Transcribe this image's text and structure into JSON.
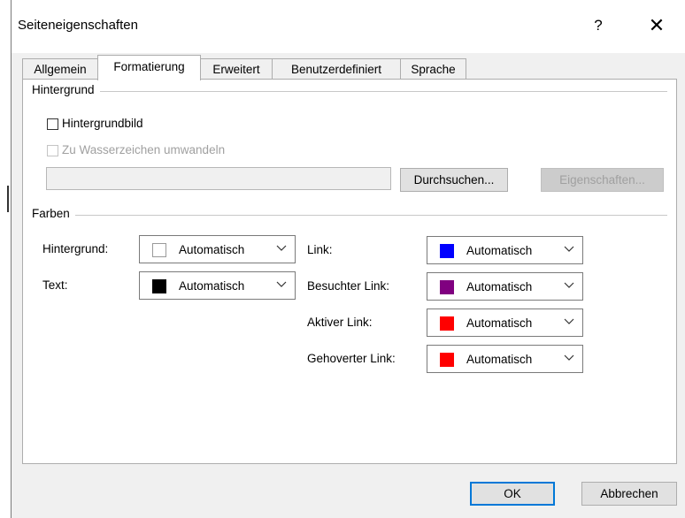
{
  "window": {
    "title": "Seiteneigenschaften",
    "help_label": "?",
    "close_label": "✕"
  },
  "tabs": [
    {
      "label": "Allgemein"
    },
    {
      "label": "Formatierung",
      "active": true
    },
    {
      "label": "Erweitert"
    },
    {
      "label": "Benutzerdefiniert"
    },
    {
      "label": "Sprache"
    }
  ],
  "background_group": {
    "label": "Hintergrund",
    "image_checkbox": "Hintergrundbild",
    "watermark_checkbox": "Zu Wasserzeichen umwandeln",
    "path_value": "",
    "browse_button": "Durchsuchen...",
    "properties_button": "Eigenschaften..."
  },
  "colors_group": {
    "label": "Farben",
    "background": {
      "label": "Hintergrund:",
      "value": "Automatisch",
      "swatch": "#ffffff"
    },
    "text": {
      "label": "Text:",
      "value": "Automatisch",
      "swatch": "#000000"
    },
    "link": {
      "label": "Link:",
      "value": "Automatisch",
      "swatch": "#0000ff"
    },
    "visited_link": {
      "label": "Besuchter Link:",
      "value": "Automatisch",
      "swatch": "#800080"
    },
    "active_link": {
      "label": "Aktiver Link:",
      "value": "Automatisch",
      "swatch": "#ff0000"
    },
    "hover_link": {
      "label": "Gehoverter Link:",
      "value": "Automatisch",
      "swatch": "#ff0000"
    }
  },
  "footer": {
    "ok_button": "OK",
    "cancel_button": "Abbrechen"
  },
  "icons": {
    "chevron": "chevron-down-icon",
    "close": "close-icon",
    "help": "help-icon"
  }
}
